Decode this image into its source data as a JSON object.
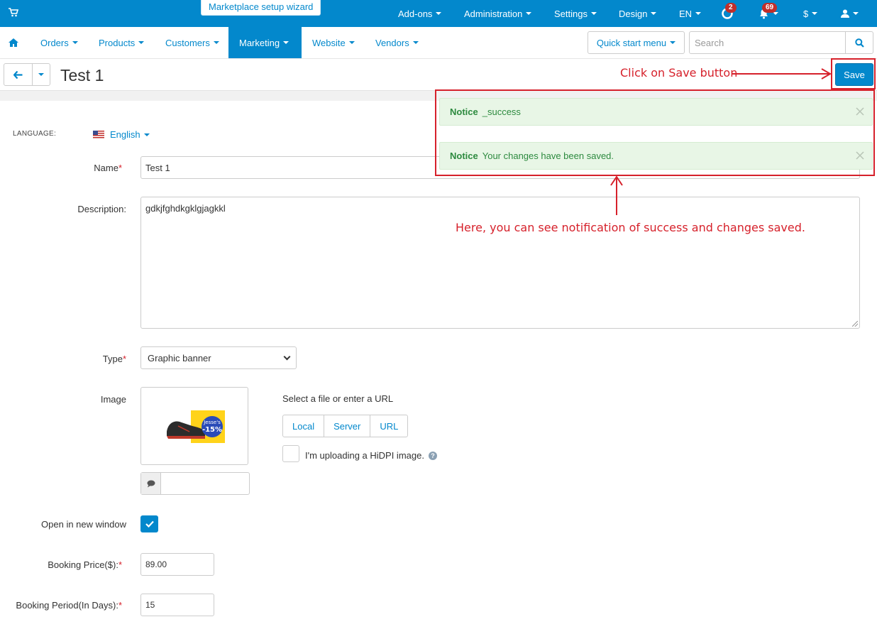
{
  "topbar": {
    "wizard": "Marketplace setup wizard",
    "menus": [
      "Add-ons",
      "Administration",
      "Settings",
      "Design",
      "EN"
    ],
    "help_badge": "2",
    "notifications_badge": "69",
    "currency": "$",
    "bg_color": "#0388cc"
  },
  "mainnav": {
    "items": [
      "Orders",
      "Products",
      "Customers",
      "Marketing",
      "Website",
      "Vendors"
    ],
    "active": "Marketing",
    "quick_start": "Quick start menu",
    "search_placeholder": "Search"
  },
  "titlebar": {
    "title": "Test 1",
    "save": "Save"
  },
  "notices": [
    {
      "title": "Notice",
      "message": "_success"
    },
    {
      "title": "Notice",
      "message": "Your changes have been saved."
    }
  ],
  "form": {
    "language_label": "LANGUAGE:",
    "language_value": "English",
    "name_label": "Name",
    "name_value": "Test 1",
    "description_label": "Description:",
    "description_value": "gdkjfghdkgklgjagkkl",
    "type_label": "Type",
    "type_value": "Graphic banner",
    "image_label": "Image",
    "image_source_hint": "Select a file or enter a URL",
    "image_sources": [
      "Local",
      "Server",
      "URL"
    ],
    "hidpi_label": "I'm uploading a HiDPI image.",
    "image_badge": [
      "Jesse's",
      "-15%"
    ],
    "open_new_window_label": "Open in new window",
    "open_new_window_checked": true,
    "booking_price_label": "Booking Price($):",
    "booking_price_value": "89.00",
    "booking_period_label": "Booking Period(In Days):",
    "booking_period_value": "15"
  },
  "annotations": {
    "save_hint": "Click on Save button",
    "notice_hint": "Here, you can see notification of success and changes saved.",
    "color": "#d6212b"
  }
}
